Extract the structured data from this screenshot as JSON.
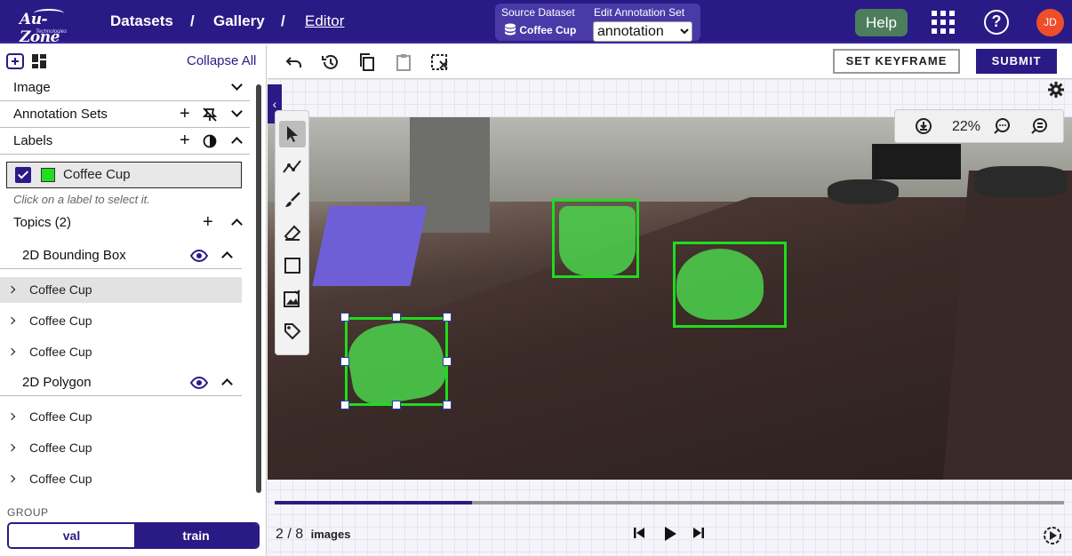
{
  "app": {
    "logo_text": "Au-Zone",
    "logo_sub": "Technologies"
  },
  "nav": {
    "breadcrumbs": [
      "Datasets",
      "Gallery",
      "Editor"
    ],
    "separator": "/"
  },
  "dataset_box": {
    "source_label": "Source Dataset",
    "source_value": "Coffee Cup",
    "edit_label": "Edit Annotation Set",
    "edit_value": "annotation"
  },
  "header": {
    "help_label": "Help",
    "user_initials": "JD",
    "help_icon": "question-circle-icon",
    "apps_icon": "apps-grid-icon"
  },
  "sidebar": {
    "collapse_all": "Collapse All",
    "sections": {
      "image": "Image",
      "annotation_sets": "Annotation Sets",
      "labels": "Labels",
      "topics": "Topics (2)"
    },
    "label_chip": {
      "name": "Coffee Cup",
      "color": "#22dd22"
    },
    "hint": "Click on a label to select it.",
    "topic_groups": [
      {
        "name": "2D Bounding Box",
        "items": [
          "Coffee Cup",
          "Coffee Cup",
          "Coffee Cup"
        ]
      },
      {
        "name": "2D Polygon",
        "items": [
          "Coffee Cup",
          "Coffee Cup",
          "Coffee Cup"
        ]
      }
    ],
    "group_label": "GROUP",
    "group_options": [
      "val",
      "train"
    ],
    "group_selected": "train"
  },
  "toolbar": {
    "set_keyframe": "SET KEYFRAME",
    "submit": "SUBMIT"
  },
  "viewer": {
    "zoom": "22%"
  },
  "footer": {
    "page_current": "2",
    "page_sep": "/",
    "page_total": "8",
    "page_unit": "images",
    "progress_fraction": 0.25
  },
  "colors": {
    "brand": "#2a1a85",
    "annotation": "#1fdc1f",
    "help": "#4c7d5d",
    "avatar": "#ef4e2a"
  }
}
